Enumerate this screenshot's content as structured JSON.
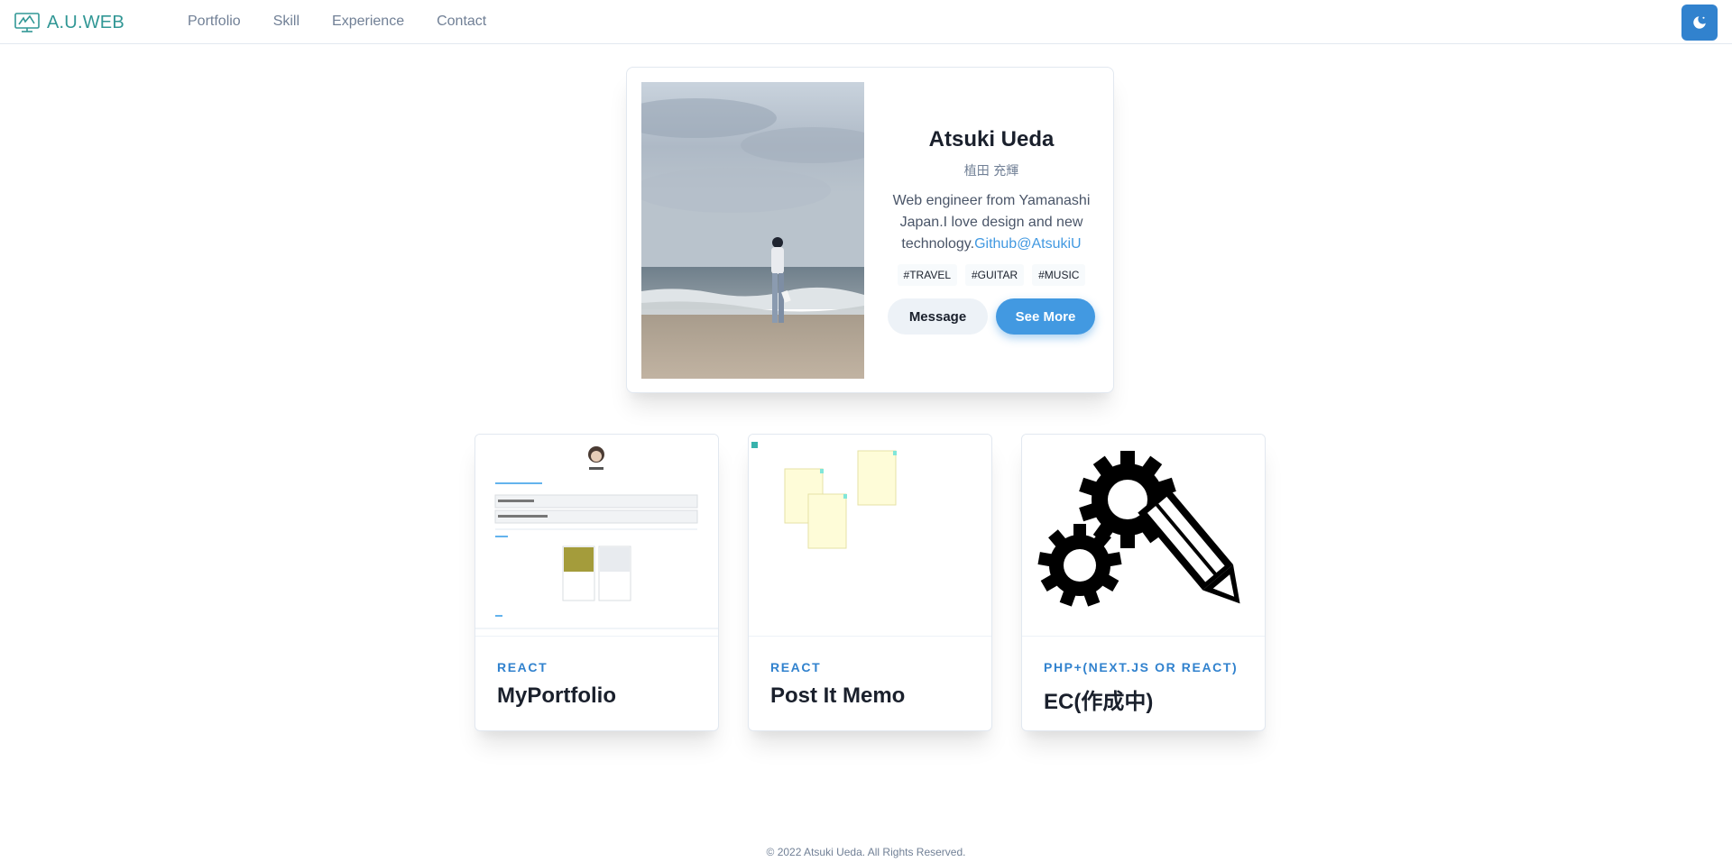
{
  "header": {
    "logo_text": "A.U.WEB",
    "nav": [
      "Portfolio",
      "Skill",
      "Experience",
      "Contact"
    ],
    "theme_toggle_icon": "moon-icon",
    "colors": {
      "brand": "#319795",
      "accent": "#3182ce"
    }
  },
  "profile": {
    "name": "Atsuki Ueda",
    "name_kana": "植田 充輝",
    "bio": "Web engineer from Yamanashi Japan.I love design and new technology.",
    "github_link": "Github@AtsukiU",
    "tags": [
      "#TRAVEL",
      "#GUITAR",
      "#MUSIC"
    ],
    "buttons": {
      "message": "Message",
      "see_more": "See More"
    }
  },
  "portfolio": [
    {
      "category": "REACT",
      "title": "MyPortfolio"
    },
    {
      "category": "REACT",
      "title": "Post It Memo"
    },
    {
      "category": "PHP+(NEXT.JS OR REACT)",
      "title": "EC(作成中)"
    }
  ],
  "footer": {
    "text": "© 2022 Atsuki Ueda. All Rights Reserved."
  }
}
